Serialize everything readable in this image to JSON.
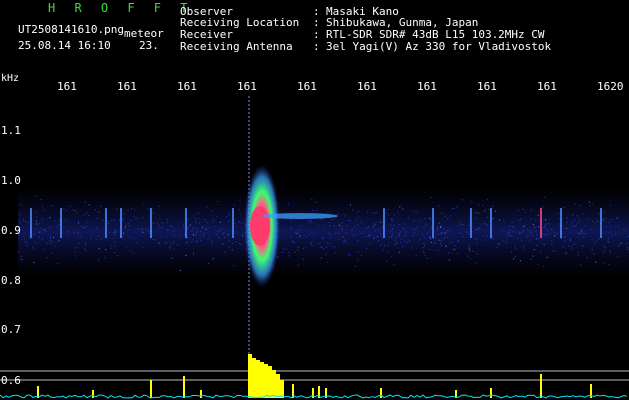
{
  "header": {
    "program_name": "H R O F F T",
    "filename": "UT2508141610.png",
    "detection_tag": "meteor",
    "datetime": "25.08.14 16:10",
    "count": "23.",
    "rows": [
      {
        "label": "Observer",
        "sep": ":",
        "value": "Masaki Kano"
      },
      {
        "label": "Receiving Location",
        "sep": ":",
        "value": "Shibukawa, Gunma, Japan"
      },
      {
        "label": "Receiver",
        "sep": ":",
        "value": "RTL-SDR SDR# 43dB L15 103.2MHz CW"
      },
      {
        "label": "Receiving Antenna",
        "sep": ":",
        "value": "3el Yagi(V) Az 330 for Vladivostok"
      }
    ]
  },
  "axes": {
    "y_unit": "kHz",
    "y_ticks": [
      "1.1",
      "1.0",
      "0.9",
      "0.8",
      "0.7",
      "0.6"
    ],
    "x_ticks": [
      "161",
      "161",
      "161",
      "161",
      "161",
      "161",
      "161",
      "161",
      "161",
      "1620"
    ]
  },
  "colors": {
    "background": "#000000",
    "noise": "#1e2a8a",
    "echo_core": "#ff3b6b",
    "echo_mid": "#3cff6a",
    "echo_outer": "#3aa0ff",
    "power_trace": "#ffff00",
    "baseline": "#00e5ff",
    "header_green": "#3fdc3f"
  }
}
